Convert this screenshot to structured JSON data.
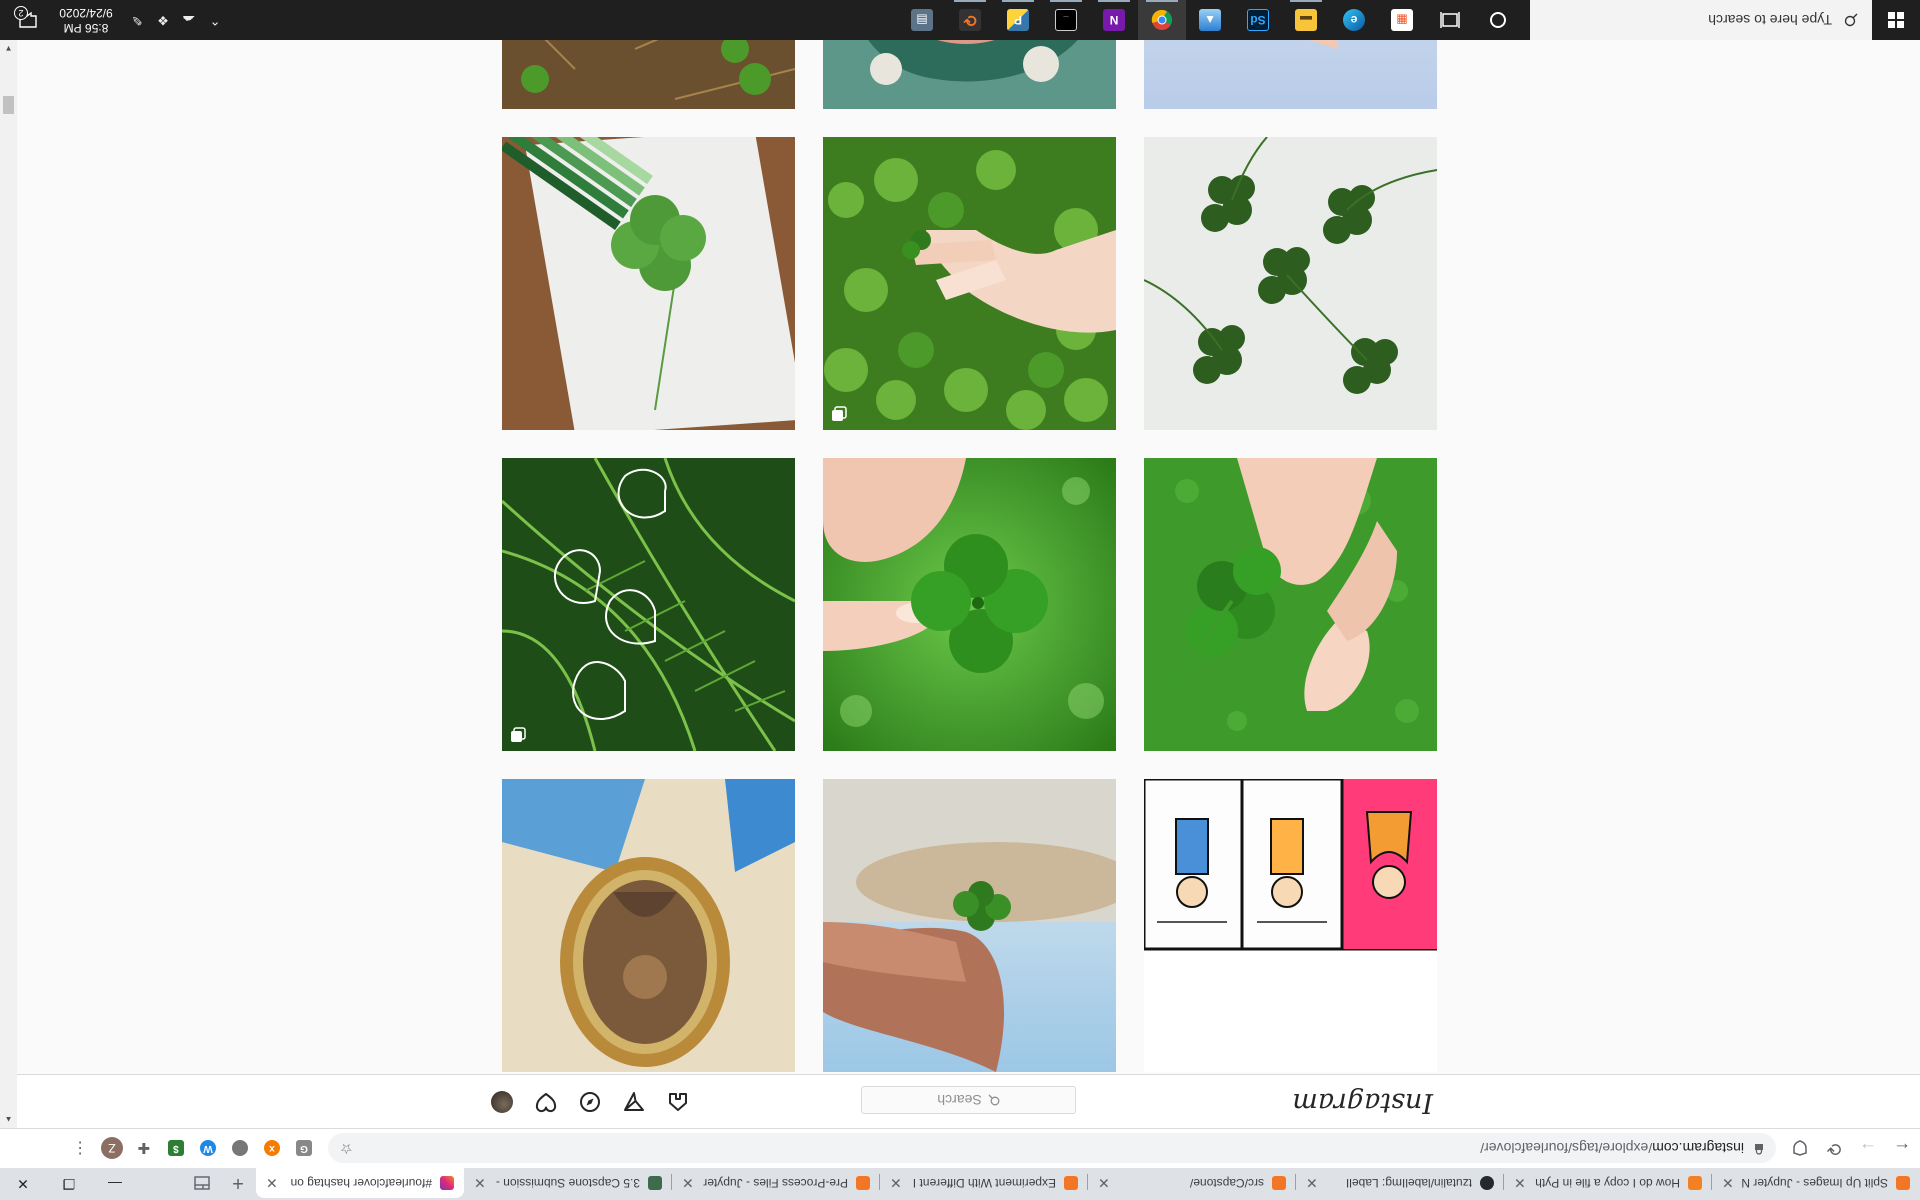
{
  "taskbar": {
    "search_placeholder": "Type here to search",
    "apps": [
      {
        "name": "task-view-icon"
      },
      {
        "name": "microsoft-edge-icon"
      },
      {
        "name": "file-explorer-icon"
      },
      {
        "name": "microsoft-store-icon"
      },
      {
        "name": "photoshop-icon",
        "label": "Ps"
      },
      {
        "name": "photos-icon"
      },
      {
        "name": "chrome-icon"
      },
      {
        "name": "onenote-icon",
        "label": "N"
      },
      {
        "name": "terminal-icon"
      },
      {
        "name": "python-icon"
      },
      {
        "name": "jupyter-icon"
      },
      {
        "name": "calculator-icon"
      }
    ],
    "time": "8:56 PM",
    "date": "9/24/2020",
    "notification_count": "2"
  },
  "browser": {
    "tabs": [
      {
        "title": "Split Up Images - Jupyter N",
        "color": "#f37626"
      },
      {
        "title": "How do I copy a file in Pyth",
        "color": "#f48024"
      },
      {
        "title": "tzutalin/labelImg: LabelI",
        "color": "#24292e"
      },
      {
        "title": "src/Capstone/",
        "color": "#f37626"
      },
      {
        "title": "Experiment With Different I",
        "color": "#f37626"
      },
      {
        "title": "Pre-Process Files - Jupyter I",
        "color": "#f37626"
      },
      {
        "title": "3.5 Capstone Submission - I",
        "color": "#3d6b4b"
      },
      {
        "title": "#fourleafclover hashtag on",
        "color": "#d6249f"
      }
    ],
    "active_tab": 7,
    "url_host": "instagram.com",
    "url_path": "/explore/tags/fourleafclover/",
    "profile_initial": "Z"
  },
  "instagram": {
    "logo": "Instagram",
    "search_placeholder": "Search"
  },
  "posts": [
    {
      "name": "post-comic-strip"
    },
    {
      "name": "post-hand-clover-beach"
    },
    {
      "name": "post-vintage-frame"
    },
    {
      "name": "post-hand-holding-clover-grass"
    },
    {
      "name": "post-fingers-clover-closeup"
    },
    {
      "name": "post-palm-leaves-drawing",
      "carousel": true
    },
    {
      "name": "post-clovers-on-white"
    },
    {
      "name": "post-hand-in-clover-patch",
      "carousel": true
    },
    {
      "name": "post-pencil-clover-drawing"
    },
    {
      "name": "post-hand-clover-street"
    },
    {
      "name": "post-cartoon-cat-clover"
    },
    {
      "name": "post-clover-on-ground"
    }
  ]
}
